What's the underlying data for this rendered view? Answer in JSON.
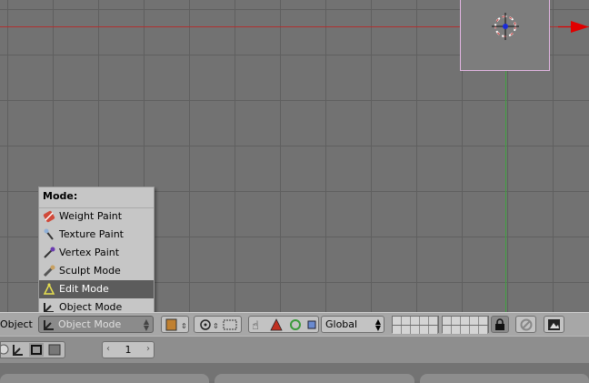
{
  "viewport": {
    "colors": {
      "background": "#727272",
      "grid": "#5f5f5f",
      "x_axis": "#b03030",
      "y_axis": "#3ea23e",
      "selection_outline": "#e2b5e2",
      "arrow": "#e00000"
    }
  },
  "mode_menu": {
    "title": "Mode:",
    "items": [
      {
        "label": "Weight Paint",
        "icon": "weight-paint-icon",
        "active": false
      },
      {
        "label": "Texture Paint",
        "icon": "texture-paint-icon",
        "active": false
      },
      {
        "label": "Vertex Paint",
        "icon": "vertex-paint-icon",
        "active": false
      },
      {
        "label": "Sculpt Mode",
        "icon": "sculpt-mode-icon",
        "active": false
      },
      {
        "label": "Edit Mode",
        "icon": "edit-mode-icon",
        "active": true
      },
      {
        "label": "Object Mode",
        "icon": "object-mode-icon",
        "active": false
      }
    ]
  },
  "header": {
    "menu_label": "Object",
    "mode_select": {
      "value": "Object Mode",
      "icon": "object-mode-icon"
    },
    "orientation": {
      "value": "Global"
    },
    "icons": [
      "draw-type-icon",
      "pivot-icon",
      "snap-icon",
      "hand-icon",
      "translate-icon",
      "rotate-icon",
      "scale-icon",
      "lock-icon",
      "link-icon",
      "render-icon"
    ]
  },
  "bottom": {
    "frame": {
      "value": "1",
      "left_arrow": "‹",
      "right_arrow": "›"
    }
  }
}
